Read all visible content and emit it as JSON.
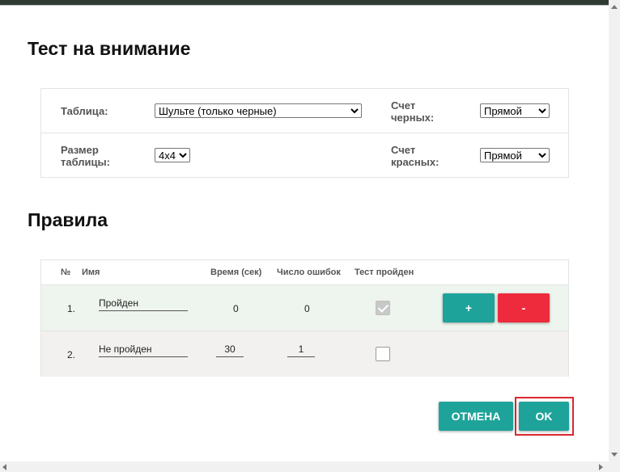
{
  "dialog": {
    "title": "Тест на внимание",
    "rules_title": "Правила"
  },
  "settings": {
    "table_label": "Таблица:",
    "table_value": "Шульте (только черные)",
    "size_label": "Размер таблицы:",
    "size_value": "4x4",
    "black_count_label": "Счет черных:",
    "black_count_value": "Прямой",
    "red_count_label": "Счет красных:",
    "red_count_value": "Прямой"
  },
  "rules": {
    "headers": {
      "num": "№",
      "name": "Имя",
      "time": "Время (сек)",
      "errors": "Число ошибок",
      "passed": "Тест пройден"
    },
    "rows": [
      {
        "num": "1.",
        "name": "Пройден",
        "time": "0",
        "errors": "0",
        "passed": true
      },
      {
        "num": "2.",
        "name": "Не пройден",
        "time": "30",
        "errors": "1",
        "passed": false
      }
    ],
    "add_label": "+",
    "remove_label": "-"
  },
  "buttons": {
    "cancel": "ОТМЕНА",
    "ok": "OK"
  },
  "colors": {
    "accent": "#1ea39a",
    "danger": "#ee2b3c",
    "focus": "#d9272e"
  }
}
